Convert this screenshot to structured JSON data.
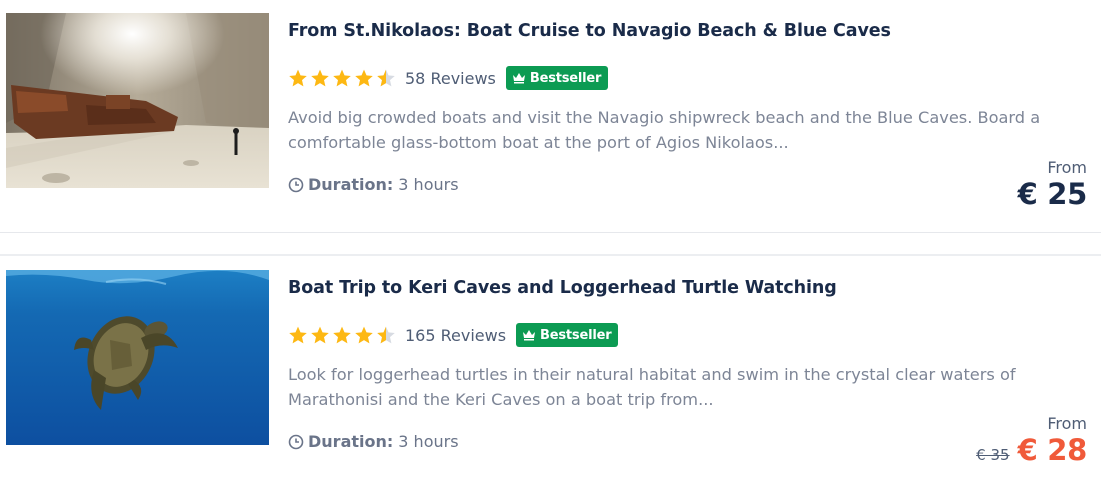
{
  "colors": {
    "title": "#1a2b49",
    "star": "#fdb813",
    "badge": "#0c9b53",
    "sale_price": "#f05a3a",
    "text_muted": "#7d8596"
  },
  "tours": [
    {
      "title": "From St.Nikolaos: Boat Cruise to Navagio Beach & Blue Caves",
      "rating": 4.5,
      "reviews": "58 Reviews",
      "badge": "Bestseller",
      "description": "Avoid big crowded boats and visit the Navagio shipwreck beach and the Blue Caves. Board a comfortable glass-bottom boat at the port of Agios Nikolaos...",
      "duration_label": "Duration:",
      "duration_value": "3 hours",
      "from_label": "From",
      "old_price": "",
      "price": "€ 25",
      "image_icon": "shipwreck-beach-photo"
    },
    {
      "title": "Boat Trip to Keri Caves and Loggerhead Turtle Watching",
      "rating": 4.5,
      "reviews": "165 Reviews",
      "badge": "Bestseller",
      "description": "Look for loggerhead turtles in their natural habitat and swim in the crystal clear waters of Marathonisi and the Keri Caves on a boat trip from...",
      "duration_label": "Duration:",
      "duration_value": "3 hours",
      "from_label": "From",
      "old_price": "€ 35",
      "price": "€ 28",
      "image_icon": "sea-turtle-photo"
    }
  ]
}
